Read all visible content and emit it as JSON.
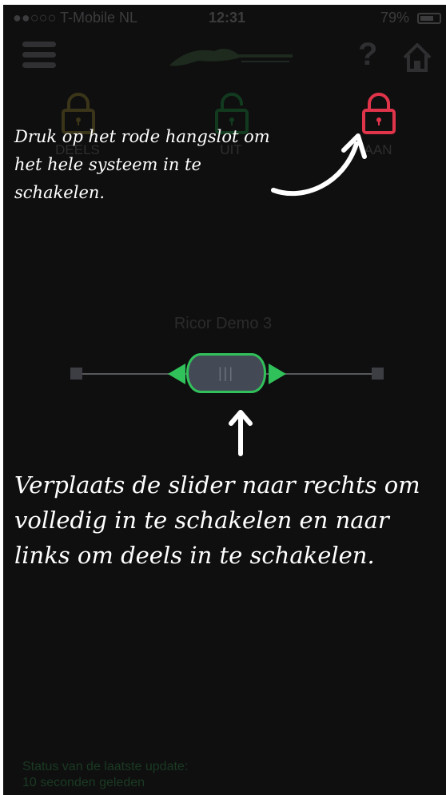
{
  "status_bar": {
    "carrier": "●●○○○ T-Mobile NL",
    "time": "12:31",
    "battery": "79%"
  },
  "header": {
    "menu_icon": "hamburger-menu-icon",
    "logo_icon": "brand-logo-icon",
    "help_label": "?",
    "home_icon": "home-icon"
  },
  "modes": [
    {
      "label": "DEELS",
      "icon": "lock-closed-icon",
      "color": "#3a3418"
    },
    {
      "label": "UIT",
      "icon": "lock-open-icon",
      "color": "#123a1f"
    },
    {
      "label": "AAN",
      "icon": "lock-closed-icon",
      "color": "#e0344a"
    }
  ],
  "hints": {
    "lock_hint": "Druk op het rode hangslot om het hele systeem in te schakelen.",
    "slider_hint": "Verplaats de slider naar rechts om volledig in te schakelen en naar links om deels in te schakelen."
  },
  "device": {
    "name": "Ricor Demo 3"
  },
  "slider": {
    "grip": "|||",
    "accent": "#31c15a"
  },
  "status_footer": {
    "line1": "Status van de laatste update:",
    "line2": "10 seconden geleden"
  }
}
